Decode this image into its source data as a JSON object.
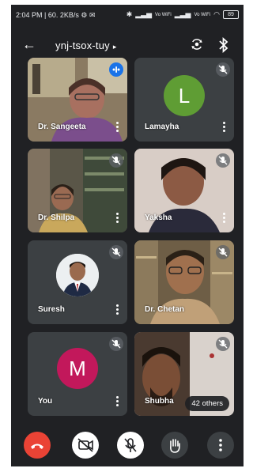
{
  "status_bar": {
    "time_speed": "2:04 PM | 60. 2KB/s",
    "wifi_labels": [
      "Vo WiFi",
      "Vo WiFi"
    ],
    "battery": "89"
  },
  "app_bar": {
    "meeting_code": "ynj-tsox-tuy",
    "caret": "▸"
  },
  "tiles": [
    {
      "name": "Dr. Sangeeta",
      "state": "speaking"
    },
    {
      "name": "Lamayha",
      "state": "muted",
      "avatar_letter": "L",
      "avatar_color": "#5f9d34"
    },
    {
      "name": "Dr. Shilpa",
      "state": "muted"
    },
    {
      "name": "Yaksha",
      "state": "muted"
    },
    {
      "name": "Suresh",
      "state": "muted"
    },
    {
      "name": "Dr. Chetan",
      "state": "muted"
    },
    {
      "name": "You",
      "state": "muted",
      "avatar_letter": "M",
      "avatar_color": "#c2185b"
    },
    {
      "name": "Shubha",
      "state": "muted"
    }
  ],
  "others_badge": "42 others",
  "controls": {
    "end_call_color": "#ea4335",
    "button_bg": "#3c4043",
    "active_bg": "#ffffff"
  }
}
